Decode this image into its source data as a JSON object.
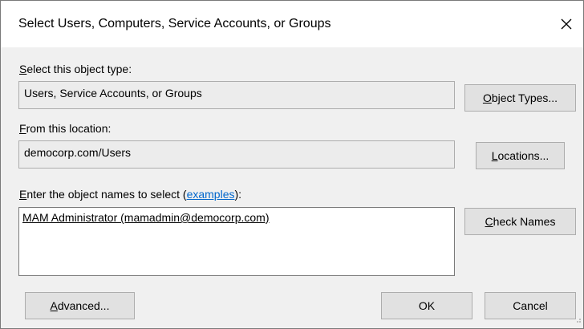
{
  "window": {
    "title": "Select Users, Computers, Service Accounts, or Groups",
    "close_icon": "close-icon"
  },
  "object_type": {
    "label_access": "S",
    "label_rest": "elect this object type:",
    "value": "Users, Service Accounts, or Groups",
    "button_access": "O",
    "button_rest": "bject Types..."
  },
  "location": {
    "label_access": "F",
    "label_rest": "rom this location:",
    "value": "democorp.com/Users",
    "button_access": "L",
    "button_rest": "ocations..."
  },
  "names": {
    "label_access": "E",
    "label_rest": "nter the object names to select (",
    "link": "examples",
    "label_end": "):",
    "entered": "MAM Administrator (mamadmin@democorp.com)",
    "check_access": "C",
    "check_rest": "heck Names"
  },
  "footer": {
    "advanced_access": "A",
    "advanced_rest": "dvanced...",
    "ok": "OK",
    "cancel": "Cancel"
  }
}
